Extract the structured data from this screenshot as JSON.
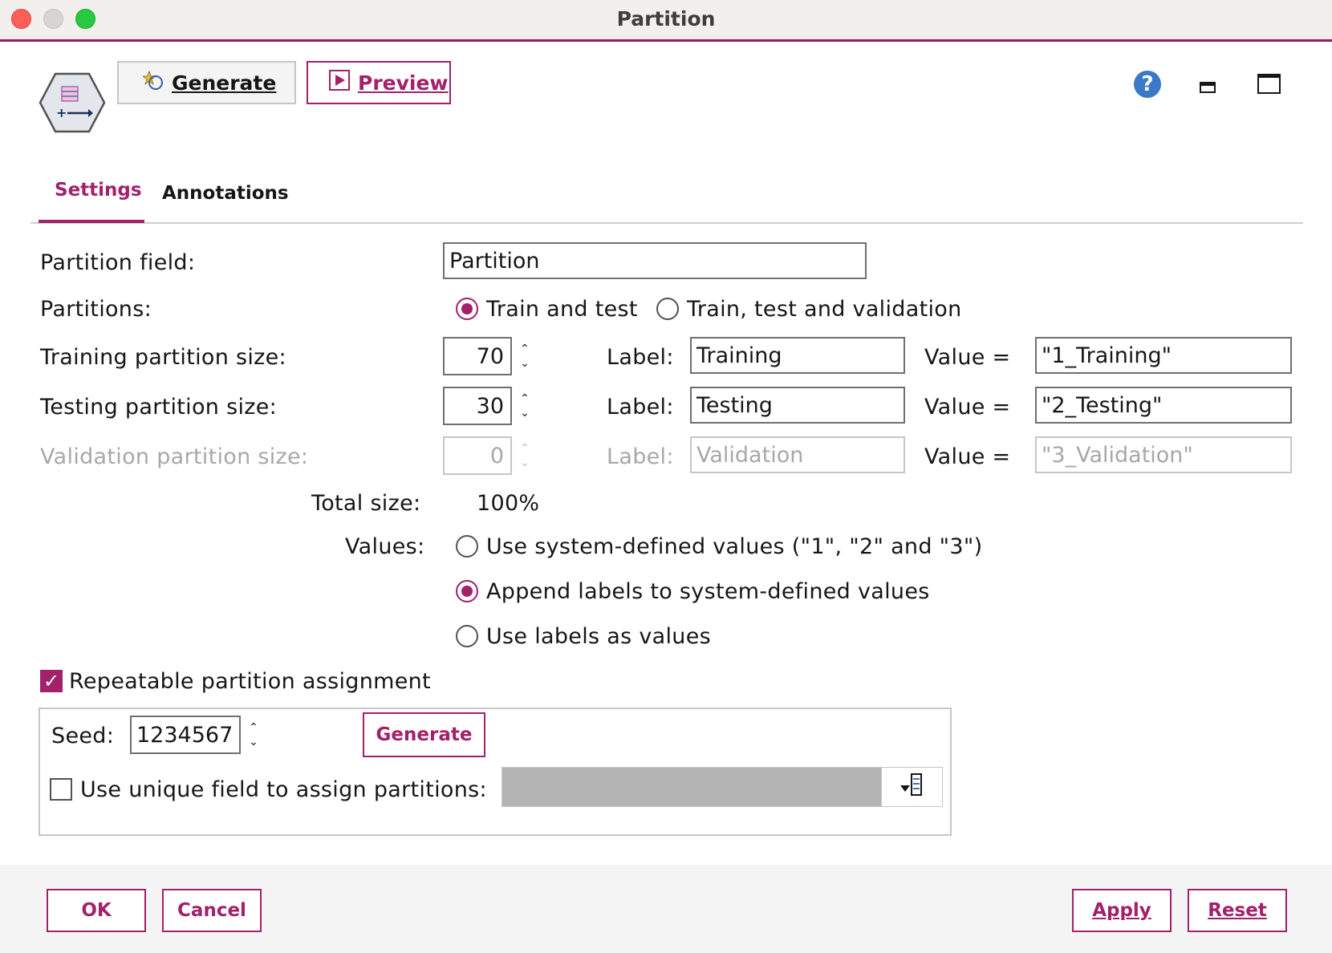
{
  "window": {
    "title": "Partition"
  },
  "toolbar": {
    "generate_label": "Generate",
    "preview_label": "Preview",
    "help_glyph": "?"
  },
  "tabs": [
    {
      "label": "Settings",
      "active": true
    },
    {
      "label": "Annotations",
      "active": false
    }
  ],
  "form": {
    "partition_field": {
      "label": "Partition field:",
      "value": "Partition"
    },
    "partitions": {
      "label": "Partitions:",
      "options": [
        {
          "label": "Train and test",
          "selected": true
        },
        {
          "label": "Train, test and validation",
          "selected": false
        }
      ]
    },
    "rows": [
      {
        "label": "Training partition size:",
        "size": "70",
        "label_caption": "Label:",
        "label_value": "Training",
        "value_caption": "Value =",
        "value": "\"1_Training\"",
        "enabled": true
      },
      {
        "label": "Testing partition size:",
        "size": "30",
        "label_caption": "Label:",
        "label_value": "Testing",
        "value_caption": "Value =",
        "value": "\"2_Testing\"",
        "enabled": true
      },
      {
        "label": "Validation partition size:",
        "size": "0",
        "label_caption": "Label:",
        "label_value": "Validation",
        "value_caption": "Value =",
        "value": "\"3_Validation\"",
        "enabled": false
      }
    ],
    "total": {
      "label": "Total size:",
      "value": "100%"
    },
    "values": {
      "label": "Values:",
      "options": [
        {
          "label": "Use system-defined values (\"1\", \"2\" and \"3\")",
          "selected": false
        },
        {
          "label": "Append labels to system-defined values",
          "selected": true
        },
        {
          "label": "Use labels as values",
          "selected": false
        }
      ]
    },
    "repeatable": {
      "label": "Repeatable partition assignment",
      "checked": true
    },
    "seed": {
      "label": "Seed:",
      "value": "1234567",
      "generate_label": "Generate"
    },
    "unique_field": {
      "label": "Use unique field to assign partitions:",
      "checked": false
    }
  },
  "footer": {
    "ok_label": "OK",
    "cancel_label": "Cancel",
    "apply_label": "Apply",
    "reset_label": "Reset"
  },
  "colors": {
    "accent": "#a3206a",
    "title_bar": "#f2efed"
  }
}
